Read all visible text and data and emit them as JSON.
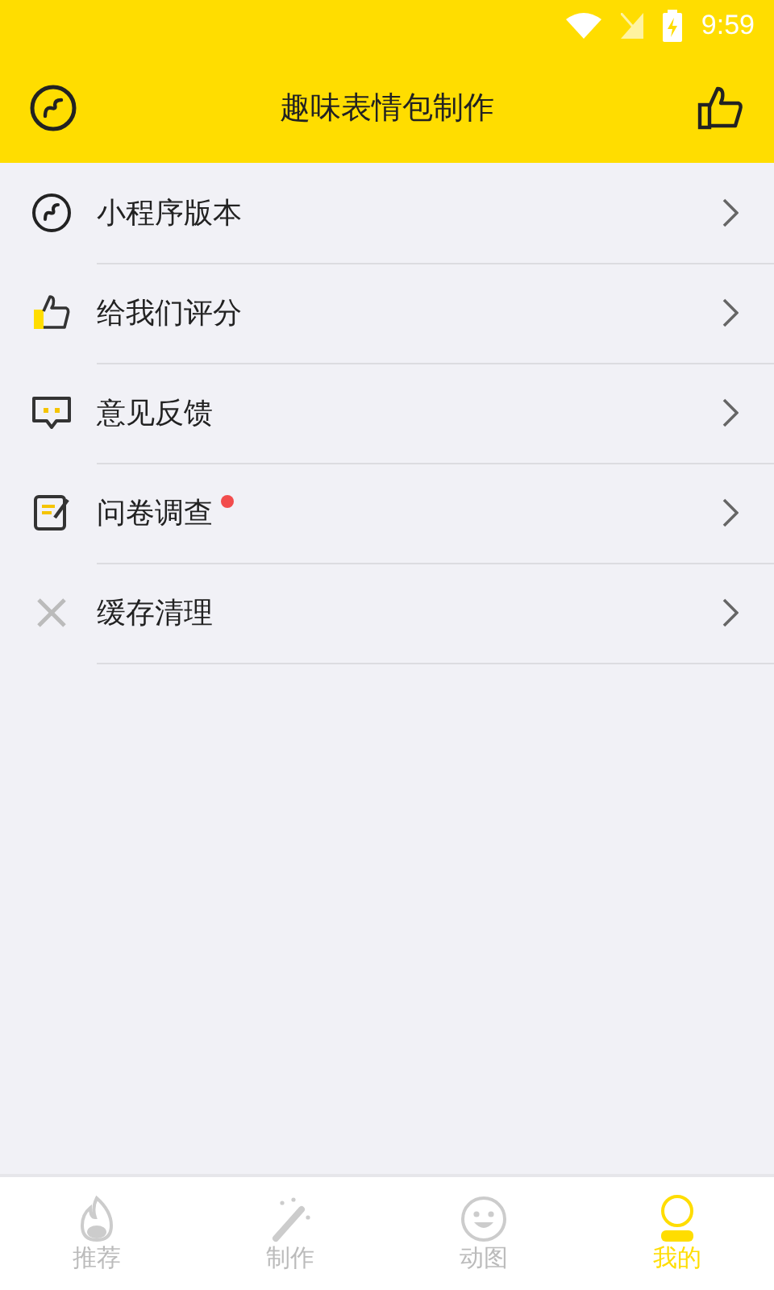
{
  "status_bar": {
    "time": "9:59"
  },
  "header": {
    "title": "趣味表情包制作"
  },
  "menu": [
    {
      "kind": "miniapp",
      "label": "小程序版本",
      "dot": false
    },
    {
      "kind": "thumb",
      "label": "给我们评分",
      "dot": false
    },
    {
      "kind": "feedback",
      "label": "意见反馈",
      "dot": false
    },
    {
      "kind": "survey",
      "label": "问卷调查",
      "dot": true
    },
    {
      "kind": "clear",
      "label": "缓存清理",
      "dot": false
    }
  ],
  "tabs": [
    {
      "kind": "fire",
      "label": "推荐",
      "selected": false
    },
    {
      "kind": "wand",
      "label": "制作",
      "selected": false
    },
    {
      "kind": "smile",
      "label": "动图",
      "selected": false
    },
    {
      "kind": "user",
      "label": "我的",
      "selected": true
    }
  ]
}
